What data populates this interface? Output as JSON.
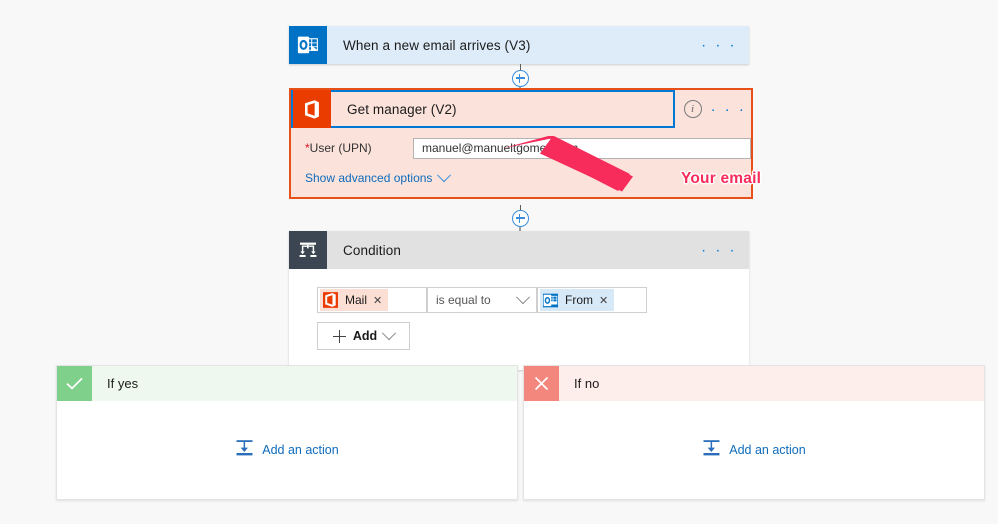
{
  "flow": {
    "trigger": {
      "title": "When a new email arrives (V3)",
      "icon": "outlook-icon",
      "menu": "· · ·"
    },
    "get_manager": {
      "title": "Get manager (V2)",
      "icon": "office365-users-icon",
      "info": "i",
      "menu": "· · ·",
      "field_label": "User (UPN)",
      "required_marker": "*",
      "field_value": "manuel@manueltgomes.com",
      "advanced_link": "Show advanced options"
    },
    "condition": {
      "title": "Condition",
      "icon": "condition-branch-icon",
      "menu": "· · ·",
      "left_token": {
        "label": "Mail",
        "icon": "office365-users-icon",
        "remove": "✕"
      },
      "operator": "is equal to",
      "right_token": {
        "label": "From",
        "icon": "outlook-icon",
        "remove": "✕"
      },
      "add_button": "Add"
    },
    "branches": [
      {
        "title": "If yes",
        "badge": "check-icon",
        "add_action": "Add an action"
      },
      {
        "title": "If no",
        "badge": "cross-icon",
        "add_action": "Add an action"
      }
    ]
  },
  "annotation": {
    "text": "Your email",
    "color": "#f72c5b",
    "arrow": "arrow-pointing-up-left"
  },
  "colors": {
    "trigger_bg": "#deecf9",
    "highlight_border": "#e8501a",
    "highlight_bg": "#fbe2da",
    "selection_outline": "#0078d4",
    "outlook_blue": "#0072c6",
    "office_orange": "#eb3c00",
    "condition_gray": "#3b4652",
    "yes_green": "#7ed08a",
    "no_red": "#f3877e",
    "link_blue": "#0f6cbd"
  }
}
